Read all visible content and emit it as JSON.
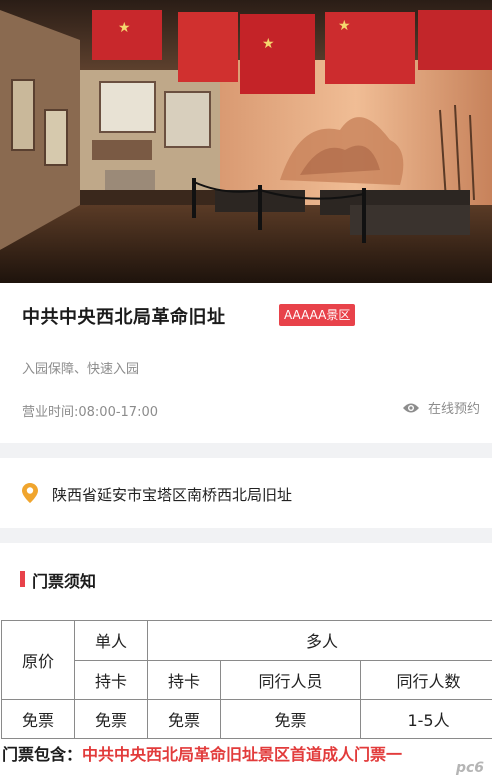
{
  "attraction": {
    "name": "中共中央西北局革命旧址",
    "rating_badge": "AAAAA景区",
    "subtitle": "入园保障、快速入园",
    "hours": "营业时间:08:00-17:00",
    "reserve_label": "在线预约"
  },
  "location": {
    "address": "陕西省延安市宝塔区南桥西北局旧址"
  },
  "ticket_notice": {
    "title": "门票须知",
    "table": {
      "row_label": "原价",
      "single_header": "单人",
      "group_header": "多人",
      "sub_headers": [
        "持卡",
        "持卡",
        "同行人员",
        "同行人数"
      ],
      "prices": [
        "免票",
        "免票",
        "免票",
        "免票",
        "1-5人"
      ]
    },
    "includes_label": "门票包含：",
    "includes_value": "中共中央西北局革命旧址景区首道成人门票一"
  },
  "watermark": "pc6",
  "colors": {
    "accent_red": "#e8424a",
    "text_gray": "#8c8c8c",
    "divider_gray": "#f1f2f4"
  },
  "icons": [
    "eye-icon",
    "location-pin-icon"
  ]
}
